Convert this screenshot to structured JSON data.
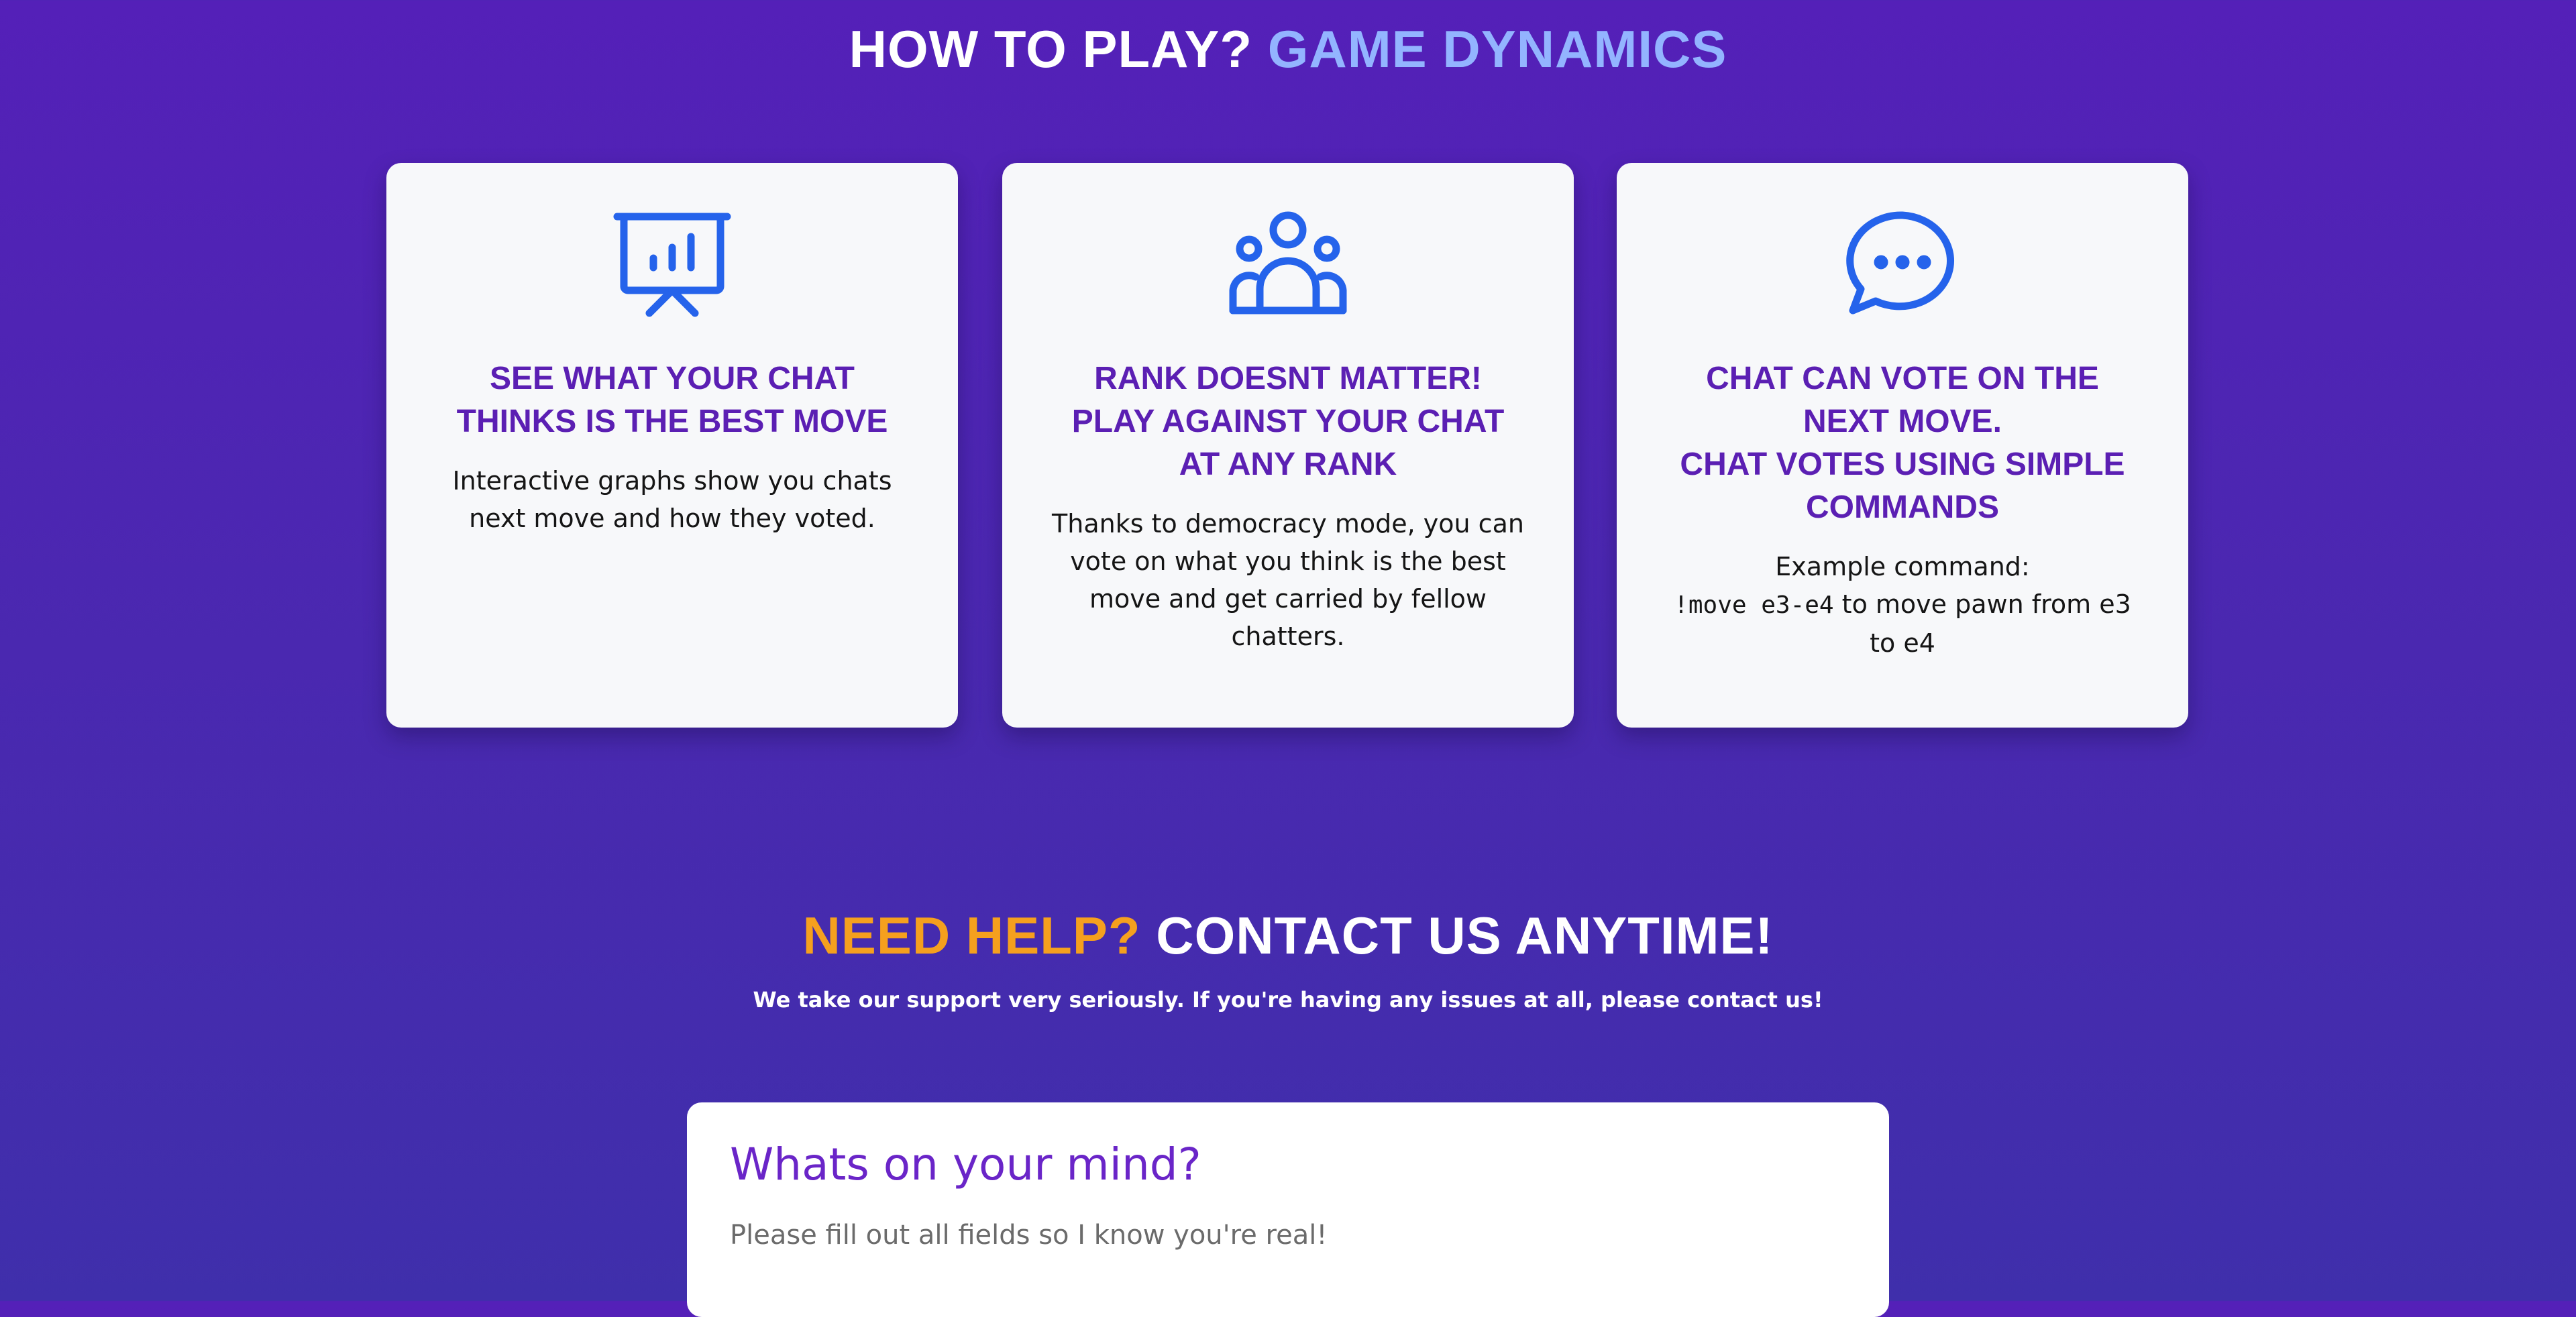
{
  "how_to_play": {
    "title_main": "HOW TO PLAY?",
    "title_accent": "GAME DYNAMICS"
  },
  "cards": [
    {
      "icon": "presentation-chart-icon",
      "title": "SEE WHAT YOUR CHAT\nTHINKS IS THE BEST MOVE",
      "text": "Interactive graphs show you chats next move and how they voted."
    },
    {
      "icon": "users-group-icon",
      "title": "RANK DOESNT MATTER!\nPLAY AGAINST YOUR CHAT\nAT ANY RANK",
      "text": "Thanks to democracy mode, you can vote on what you think is the best move and get carried by fellow chatters."
    },
    {
      "icon": "chat-bubble-icon",
      "title": "CHAT CAN VOTE ON THE\nNEXT MOVE.\nCHAT VOTES USING SIMPLE\nCOMMANDS",
      "text_lead": "Example command:",
      "text_code": "!move e3-e4",
      "text_tail": " to move pawn from e3 to e4"
    }
  ],
  "help": {
    "title_accent": "NEED HELP?",
    "title_main": "CONTACT US ANYTIME!",
    "subtitle": "We take our support very seriously. If you're having any issues at all, please contact us!"
  },
  "form": {
    "title": "Whats on your mind?",
    "subtitle": "Please fill out all fields so I know you're real!"
  },
  "colors": {
    "background_top": "#5420b8",
    "background_bottom": "#3f2fab",
    "card_title": "#5b1fb3",
    "icon_blue": "#2563eb",
    "accent_blue": "#93b4ff",
    "accent_orange": "#f5a01e",
    "form_title": "#6a25c8"
  }
}
